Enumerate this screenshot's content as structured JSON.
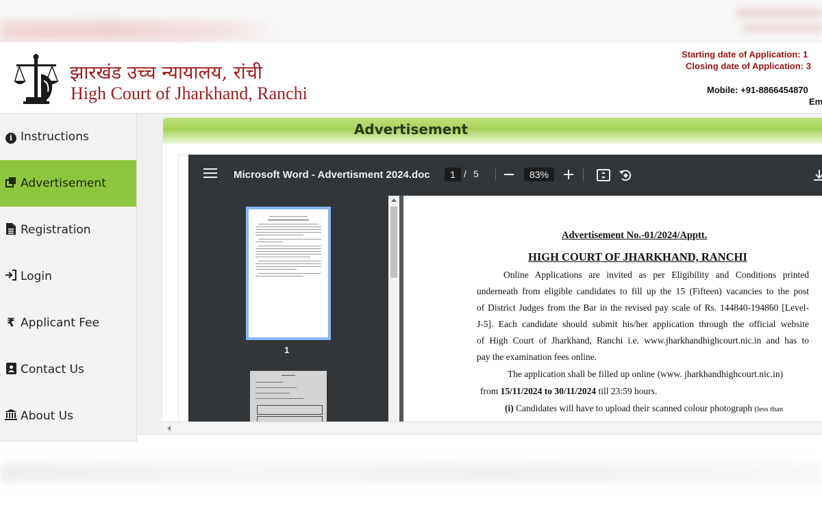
{
  "header": {
    "title_hindi": "झारखंड उच्च न्यायालय, रांची",
    "title_english": "High Court of Jharkhand, Ranchi",
    "starting_date": "Starting date of Application: 1",
    "closing_date": "Closing date of Application: 3",
    "mobile": "Mobile: +91-8866454870",
    "email": "Em"
  },
  "sidebar": {
    "items": [
      {
        "label": "Instructions",
        "icon": "info-circle-icon"
      },
      {
        "label": "Advertisement",
        "icon": "copy-icon",
        "active": true
      },
      {
        "label": "Registration",
        "icon": "file-icon"
      },
      {
        "label": "Login",
        "icon": "sign-in-icon"
      },
      {
        "label": "Applicant Fee",
        "icon": "rupee-icon"
      },
      {
        "label": "Contact Us",
        "icon": "contact-card-icon"
      },
      {
        "label": "About Us",
        "icon": "bank-icon"
      }
    ]
  },
  "main": {
    "section_title": "Advertisement"
  },
  "pdf": {
    "doc_title": "Microsoft Word - Advertisment 2024.doc",
    "current_page": "1",
    "page_separator": "/",
    "total_pages": "5",
    "zoom": "83%",
    "thumb_label": "1",
    "page": {
      "ad_number": "Advertisement No.-01/2024/Apptt.",
      "court_name": "HIGH COURT OF JHARKHAND, RANCHI",
      "para1_lines": [
        "Online Applications are invited as per Eligibility and Conditions printed",
        "underneath from eligible candidates to fill up the 15 (Fifteen) vacancies to the post",
        "of District Judges from the Bar in the revised pay scale of Rs. 144840-194860 [Level-",
        "J-5]. Each candidate should submit his/her application through the official website",
        "of High Court of Jharkhand, Ranchi i.e. www.jharkhandhighcourt.nic.in and has to",
        "pay the examination fees online."
      ],
      "para2_line1": "The application shall be filled up online (www. jharkhandhighcourt.nic.in)",
      "para2_from": "from ",
      "para2_dates": "15/11/2024 to 30/11/2024",
      "para2_rest": " till 23:59 hours.",
      "item_label": "(i)",
      "item_text": " Candidates will have to upload their scanned colour photograph ",
      "item_small": "(less than"
    }
  },
  "colors": {
    "brand_red": "#9e1c1c",
    "nav_active": "#8dc63f",
    "pdf_toolbar": "#323639"
  }
}
